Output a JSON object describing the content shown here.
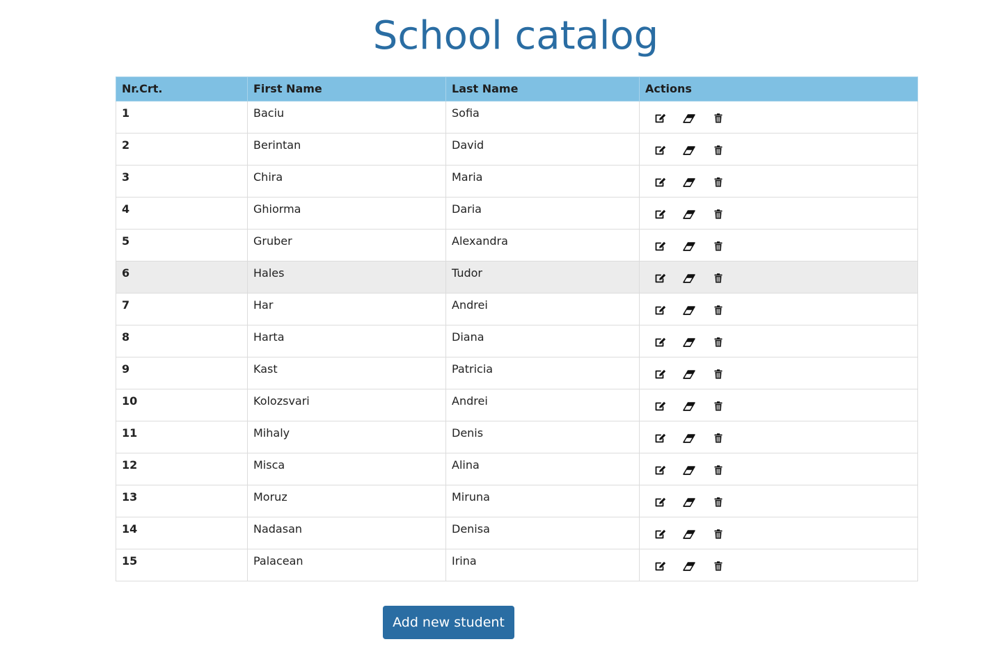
{
  "page": {
    "title": "School catalog",
    "add_button_label": "Add new student"
  },
  "table": {
    "headers": [
      "Nr.Crt.",
      "First Name",
      "Last Name",
      "Actions"
    ],
    "rows": [
      {
        "nr": "1",
        "first": "Baciu",
        "last": "Sofia"
      },
      {
        "nr": "2",
        "first": "Berintan",
        "last": "David"
      },
      {
        "nr": "3",
        "first": "Chira",
        "last": "Maria"
      },
      {
        "nr": "4",
        "first": "Ghiorma",
        "last": "Daria"
      },
      {
        "nr": "5",
        "first": "Gruber",
        "last": "Alexandra"
      },
      {
        "nr": "6",
        "first": "Hales",
        "last": "Tudor",
        "highlighted": true
      },
      {
        "nr": "7",
        "first": "Har",
        "last": "Andrei"
      },
      {
        "nr": "8",
        "first": "Harta",
        "last": "Diana"
      },
      {
        "nr": "9",
        "first": "Kast",
        "last": "Patricia"
      },
      {
        "nr": "10",
        "first": "Kolozsvari",
        "last": "Andrei"
      },
      {
        "nr": "11",
        "first": "Mihaly",
        "last": "Denis"
      },
      {
        "nr": "12",
        "first": "Misca",
        "last": "Alina"
      },
      {
        "nr": "13",
        "first": "Moruz",
        "last": "Miruna"
      },
      {
        "nr": "14",
        "first": "Nadasan",
        "last": "Denisa"
      },
      {
        "nr": "15",
        "first": "Palacean",
        "last": "Irina"
      }
    ],
    "row_actions": [
      "edit-icon",
      "eraser-icon",
      "trash-icon"
    ]
  },
  "colors": {
    "title": "#2a6da3",
    "header_bg": "#7fc0e3",
    "button_bg": "#2a6da3",
    "highlight_row": "#ececec"
  }
}
